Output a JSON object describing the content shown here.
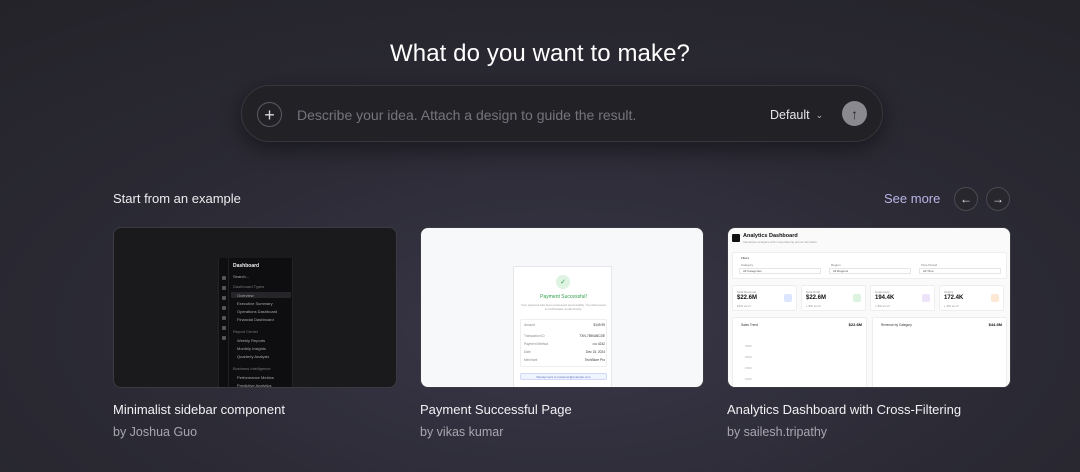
{
  "heading": "What do you want to make?",
  "prompt": {
    "placeholder": "Describe your idea. Attach a design to guide the result.",
    "add_icon": "plus-icon",
    "model": "Default",
    "send_icon": "arrow-up-icon"
  },
  "examples": {
    "title": "Start from an example",
    "see_more": "See more",
    "prev_icon": "arrow-left-icon",
    "next_icon": "arrow-right-icon",
    "cards": [
      {
        "title": "Minimalist sidebar component",
        "author": "by Joshua Guo",
        "preview": {
          "header": "Dashboard",
          "search": "Search...",
          "group1": "Dashboard Types",
          "items1": [
            "Overview",
            "Executive Summary",
            "Operations Dashboard",
            "Financial Dashboard"
          ],
          "group2": "Report Center",
          "items2": [
            "Weekly Reports",
            "Monthly Insights",
            "Quarterly Analysis"
          ],
          "group3": "Business Intelligence",
          "items3": [
            "Performance Metrics",
            "Predictive Analytics"
          ]
        }
      },
      {
        "title": "Payment Successful Page",
        "author": "by vikas kumar",
        "preview": {
          "heading": "Payment Successful!",
          "message": "Your payment has been processed successfully. You will receive a confirmation email shortly.",
          "rows": [
            {
              "label": "Amount",
              "value": "$149.99"
            },
            {
              "label": "Transaction ID",
              "value": "TXN-7890ABCDE"
            },
            {
              "label": "Payment Method",
              "value": "•••• 4242"
            },
            {
              "label": "Date",
              "value": "Dec 15, 2024"
            },
            {
              "label": "Merchant",
              "value": "TechStore Pro"
            }
          ],
          "button": "Receipt sent to customer@example.com"
        }
      },
      {
        "title": "Analytics Dashboard with Cross-Filtering",
        "author": "by sailesh.tripathy",
        "preview": {
          "heading": "Analytics Dashboard",
          "subheading": "Interactive analytics with cross-filtering across all charts",
          "filters_label": "Filters",
          "filters": [
            {
              "label": "Category",
              "value": "All Categories"
            },
            {
              "label": "Region",
              "value": "All Regions"
            },
            {
              "label": "Time Period",
              "value": "All Time"
            }
          ],
          "kpis": [
            {
              "label": "Total Revenue",
              "value": "$22.6M",
              "note": "12% vs LY"
            },
            {
              "label": "Total Profit",
              "value": "$22.6M",
              "note": "+ 8% vs LY"
            },
            {
              "label": "Customers",
              "value": "194.4K",
              "note": "+ 5% vs LY"
            },
            {
              "label": "Orders",
              "value": "172.4K",
              "note": "+ 3% vs LY"
            }
          ],
          "panels": [
            {
              "title": "Sales Trend",
              "value": "$22.6M",
              "ticks": [
                "2500",
                "2000",
                "1500",
                "1000"
              ]
            },
            {
              "title": "Revenue by Category",
              "value": "$44.6M"
            }
          ]
        }
      }
    ]
  },
  "colors": {
    "accent_link": "#b9b4e8",
    "success": "#2e9e4a",
    "background": "#2c2b36"
  }
}
